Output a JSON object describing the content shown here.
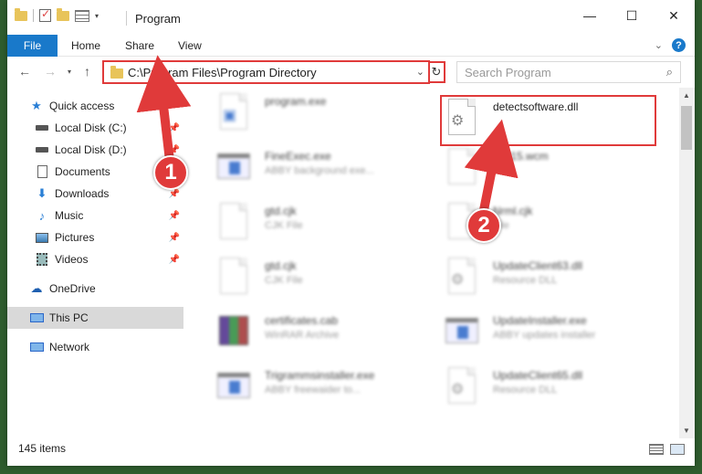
{
  "window": {
    "title": "Program",
    "controls": {
      "minimize": "—",
      "maximize": "☐",
      "close": "✕"
    }
  },
  "ribbon": {
    "tabs": [
      "File",
      "Home",
      "Share",
      "View"
    ]
  },
  "nav": {
    "address": "C:\\Program Files\\Program Directory",
    "search_placeholder": "Search Program"
  },
  "sidebar": {
    "items": [
      {
        "label": "Quick access",
        "icon": "star-icon"
      },
      {
        "label": "Local Disk (C:)",
        "icon": "drive-icon",
        "pinned": true
      },
      {
        "label": "Local Disk (D:)",
        "icon": "drive-icon",
        "pinned": true
      },
      {
        "label": "Documents",
        "icon": "documents-icon",
        "pinned": true
      },
      {
        "label": "Downloads",
        "icon": "download-icon",
        "pinned": true
      },
      {
        "label": "Music",
        "icon": "music-icon",
        "pinned": true
      },
      {
        "label": "Pictures",
        "icon": "pictures-icon",
        "pinned": true
      },
      {
        "label": "Videos",
        "icon": "videos-icon",
        "pinned": true
      },
      {
        "label": "OneDrive",
        "icon": "cloud-icon"
      },
      {
        "label": "This PC",
        "icon": "computer-icon",
        "selected": true
      },
      {
        "label": "Network",
        "icon": "network-icon"
      }
    ]
  },
  "files": [
    {
      "name": "program.exe",
      "desc": "",
      "icon": "installer"
    },
    {
      "name": "detectsoftware.dll",
      "desc": "",
      "icon": "dll"
    },
    {
      "name": "FineExec.exe",
      "desc": "ABBY background exe...",
      "icon": "exe"
    },
    {
      "name": "WP15.wcm",
      "desc": "File",
      "icon": "doc"
    },
    {
      "name": "gtd.cjk",
      "desc": "CJK File",
      "icon": "doc"
    },
    {
      "name": "Nrml.cjk",
      "desc": "File",
      "icon": "doc"
    },
    {
      "name": "gtd.cjk",
      "desc": "CJK File",
      "icon": "doc"
    },
    {
      "name": "UpdateClient63.dll",
      "desc": "Resource DLL",
      "icon": "dll"
    },
    {
      "name": "certificates.cab",
      "desc": "WinRAR Archive",
      "icon": "rar"
    },
    {
      "name": "UpdateInstaller.exe",
      "desc": "ABBY updates installer",
      "icon": "exe"
    },
    {
      "name": "Trigrammsinstaller.exe",
      "desc": "ABBY freewaider to...",
      "icon": "exe"
    },
    {
      "name": "UpdateClient65.dll",
      "desc": "Resource DLL",
      "icon": "dll"
    }
  ],
  "status": {
    "items_count": "145 items"
  },
  "callouts": [
    "1",
    "2"
  ]
}
